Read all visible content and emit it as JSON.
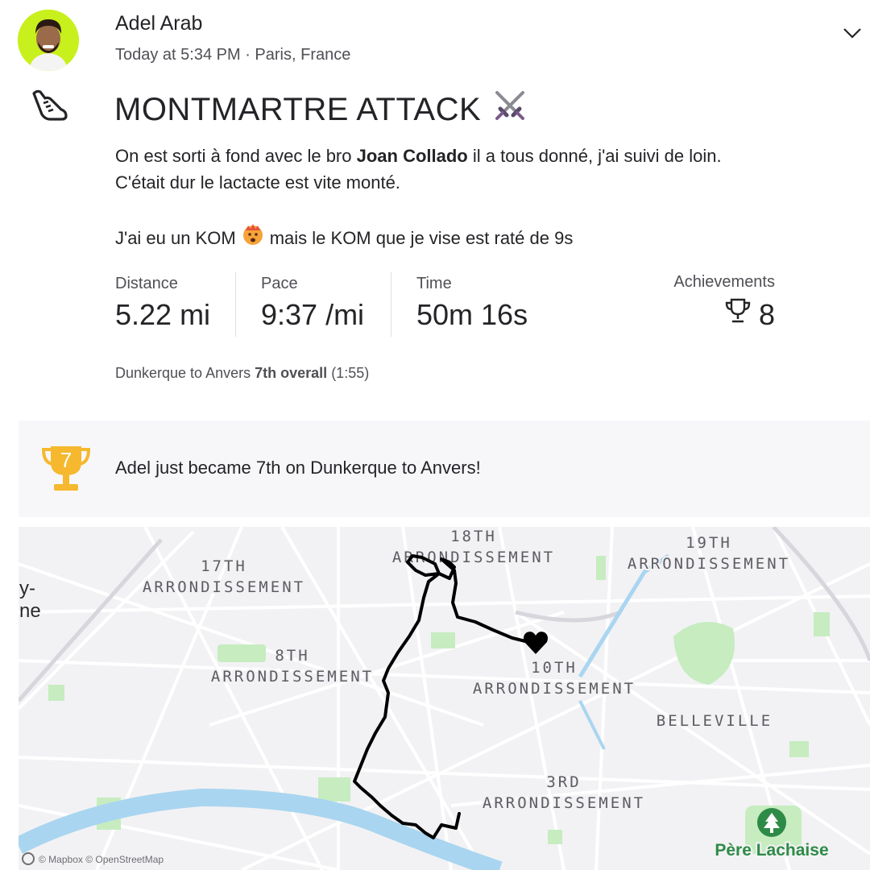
{
  "header": {
    "athlete_name": "Adel Arab",
    "meta": "Today at 5:34 PM · Paris, France",
    "menu_icon": "chevron-down-icon"
  },
  "activity": {
    "sport_icon": "running-shoe-icon",
    "title": "MONTMARTRE ATTACK",
    "title_emoji": "crossed-swords-icon",
    "description": {
      "p1_before": "On est sorti à fond avec le bro ",
      "p1_bold": "Joan Collado",
      "p1_after": " il a tous donné, j'ai suivi de loin. C'était dur le lactacte est vite monté.",
      "p2_before": "J'ai eu un KOM ",
      "p2_emoji": "crown-face-icon",
      "p2_after": " mais le KOM que je vise est raté de 9s"
    },
    "stats": [
      {
        "label": "Distance",
        "value": "5.22 mi"
      },
      {
        "label": "Pace",
        "value": "9:37 /mi"
      },
      {
        "label": "Time",
        "value": "50m 16s"
      }
    ],
    "achievements": {
      "label": "Achievements",
      "value": "8",
      "icon": "trophy-icon"
    },
    "segment": {
      "name": "Dunkerque to Anvers",
      "rank": "7th overall",
      "time": "(1:55)"
    }
  },
  "banner": {
    "rank_number": "7",
    "text": "Adel just became 7th on Dunkerque to Anvers!",
    "icon": "gold-trophy-icon"
  },
  "map": {
    "labels": {
      "a18_num": "18TH",
      "a18_word": "ARRONDISSEMENT",
      "a19_num": "19TH",
      "a19_word": "ARRONDISSEMENT",
      "a17_num": "17TH",
      "a17_word": "ARRONDISSEMENT",
      "a8_num": "8TH",
      "a8_word": "ARRONDISSEMENT",
      "a10_num": "10TH",
      "a10_word": "ARRONDISSEMENT",
      "belleville": "BELLEVILLE",
      "a3_num": "3RD",
      "a3_word": "ARRONDISSEMENT",
      "pere_lachaise": "Père Lachaise",
      "edge_fragment_1": "y-",
      "edge_fragment_2": "ne",
      "attribution": "© Mapbox © OpenStreetMap"
    },
    "end_marker": "heart-icon",
    "route_color": "#000000",
    "park_color": "#c6ecc0",
    "water_color": "#a9d5f0"
  },
  "colors": {
    "avatar_bg": "#c8f01c",
    "trophy_gold": "#f5b82e",
    "text_primary": "#242428",
    "text_secondary": "#4f4f55"
  }
}
